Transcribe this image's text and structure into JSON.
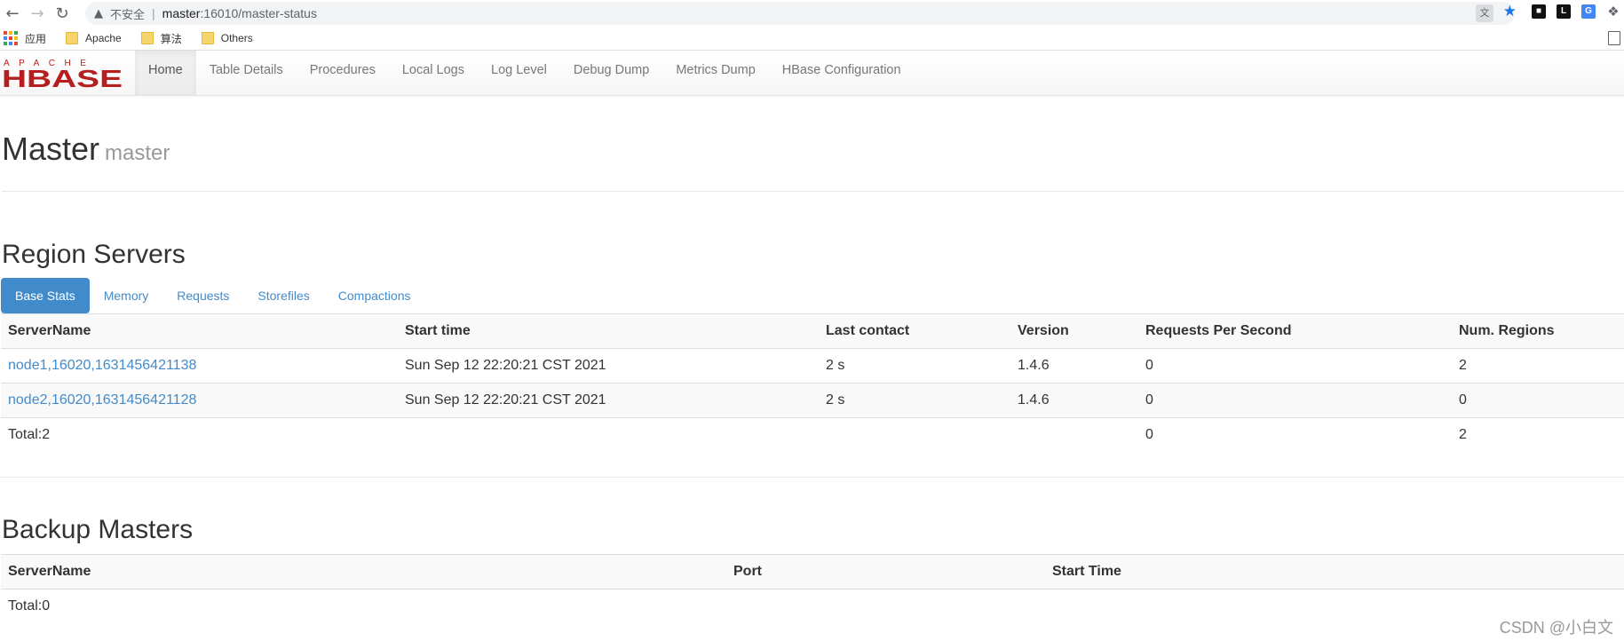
{
  "browser": {
    "insecure_label": "不安全",
    "url_host": "master",
    "url_path": ":16010/master-status",
    "bookmarks": [
      {
        "label": "应用"
      },
      {
        "label": "Apache"
      },
      {
        "label": "算法"
      },
      {
        "label": "Others"
      }
    ]
  },
  "colors": {
    "accent": "#428bca",
    "folder": "#f6d66c",
    "logo_red": "#b5201f"
  },
  "navbar": {
    "logo_top": "APACHE",
    "logo_main": "HBASE",
    "links": [
      {
        "label": "Home"
      },
      {
        "label": "Table Details"
      },
      {
        "label": "Procedures"
      },
      {
        "label": "Local Logs"
      },
      {
        "label": "Log Level"
      },
      {
        "label": "Debug Dump"
      },
      {
        "label": "Metrics Dump"
      },
      {
        "label": "HBase Configuration"
      }
    ]
  },
  "header": {
    "title": "Master",
    "subtitle": "master"
  },
  "region_servers": {
    "title": "Region Servers",
    "tabs": [
      {
        "label": "Base Stats"
      },
      {
        "label": "Memory"
      },
      {
        "label": "Requests"
      },
      {
        "label": "Storefiles"
      },
      {
        "label": "Compactions"
      }
    ],
    "columns": [
      "ServerName",
      "Start time",
      "Last contact",
      "Version",
      "Requests Per Second",
      "Num. Regions"
    ],
    "rows": [
      [
        "node1,16020,1631456421138",
        "Sun Sep 12 22:20:21 CST 2021",
        "2 s",
        "1.4.6",
        "0",
        "2"
      ],
      [
        "node2,16020,1631456421128",
        "Sun Sep 12 22:20:21 CST 2021",
        "2 s",
        "1.4.6",
        "0",
        "0"
      ]
    ],
    "total": {
      "label": "Total:2",
      "requests": "0",
      "regions": "2"
    }
  },
  "backup_masters": {
    "title": "Backup Masters",
    "columns": [
      "ServerName",
      "Port",
      "Start Time"
    ],
    "total": "Total:0"
  },
  "watermark": "CSDN @小白文"
}
